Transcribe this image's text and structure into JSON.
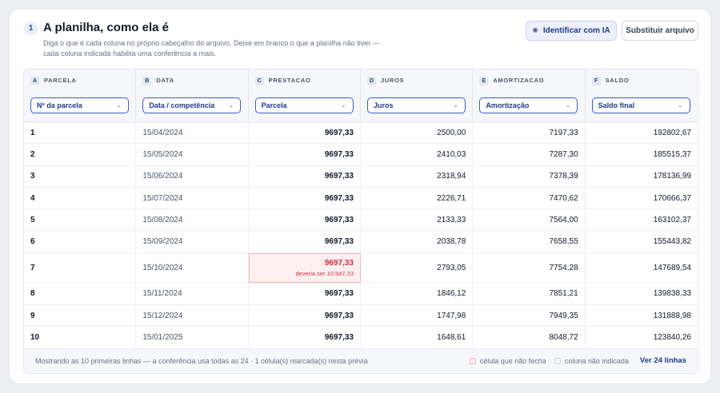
{
  "step": {
    "number": "1",
    "title": "A planilha, como ela é",
    "description": "Diga o que é cada coluna no próprio cabeçalho do arquivo. Deixe em branco o que a planilha não tiver — cada coluna indicada habilita uma conferência a mais."
  },
  "actions": {
    "identify_label": "Identificar com IA",
    "replace_label": "Substituir arquivo"
  },
  "columns": [
    {
      "letter": "A",
      "name": "PARCELA",
      "mapping": "Nº da parcela"
    },
    {
      "letter": "B",
      "name": "DATA",
      "mapping": "Data / competência"
    },
    {
      "letter": "C",
      "name": "PRESTACAO",
      "mapping": "Parcela"
    },
    {
      "letter": "D",
      "name": "JUROS",
      "mapping": "Juros"
    },
    {
      "letter": "E",
      "name": "AMORTIZACAO",
      "mapping": "Amortização"
    },
    {
      "letter": "F",
      "name": "SALDO",
      "mapping": "Saldo final"
    }
  ],
  "rows": [
    [
      "1",
      "15/04/2024",
      "9697,33",
      "2500,00",
      "7197,33",
      "192802,67"
    ],
    [
      "2",
      "15/05/2024",
      "9697,33",
      "2410,03",
      "7287,30",
      "185515,37"
    ],
    [
      "3",
      "15/06/2024",
      "9697,33",
      "2318,94",
      "7378,39",
      "178136,99"
    ],
    [
      "4",
      "15/07/2024",
      "9697,33",
      "2226,71",
      "7470,62",
      "170666,37"
    ],
    [
      "5",
      "15/08/2024",
      "9697,33",
      "2133,33",
      "7564,00",
      "163102,37"
    ],
    [
      "6",
      "15/09/2024",
      "9697,33",
      "2038,78",
      "7658,55",
      "155443,82"
    ],
    [
      "7",
      "15/10/2024",
      "9697,33",
      "2793,05",
      "7754,28",
      "147689,54"
    ],
    [
      "8",
      "15/11/2024",
      "9697,33",
      "1846,12",
      "7851,21",
      "139838,33"
    ],
    [
      "9",
      "15/12/2024",
      "9697,33",
      "1747,98",
      "7949,35",
      "131888,98"
    ],
    [
      "10",
      "15/01/2025",
      "9697,33",
      "1648,61",
      "8048,72",
      "123840,26"
    ]
  ],
  "flagged": {
    "hint": "deveria ser 10.547,33"
  },
  "footer": {
    "note": "Mostrando as 10 primeiras linhas — a conferência usa todas as 24 · 1 célula(s) marcada(s) nesta prévia",
    "legend_bad": "célula que não fecha",
    "legend_unmapped": "coluna não indicada",
    "view_all": "Ver 24 linhas"
  },
  "icons": {
    "ai": "sparkle-icon",
    "select": "chevron-down-icon"
  }
}
